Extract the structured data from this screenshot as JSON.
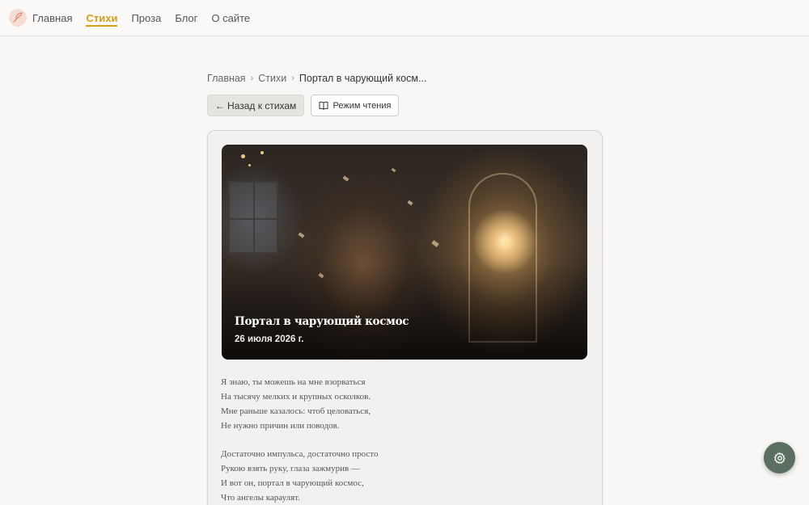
{
  "nav": {
    "items": [
      {
        "label": "Главная",
        "active": false
      },
      {
        "label": "Стихи",
        "active": true
      },
      {
        "label": "Проза",
        "active": false
      },
      {
        "label": "Блог",
        "active": false
      },
      {
        "label": "О сайте",
        "active": false
      }
    ],
    "accent_color": "#d4a017"
  },
  "breadcrumb": {
    "items": [
      "Главная",
      "Стихи"
    ],
    "current": "Портал в чарующий косм..."
  },
  "actions": {
    "back_label": "← Назад к стихам",
    "reading_mode_label": "Режим чтения"
  },
  "poem": {
    "title": "Портал в чарующий космос",
    "date": "26 июля 2026 г.",
    "stanzas": [
      [
        "Я знаю, ты можешь на мне взорваться",
        "На тысячу мелких и крупных осколков.",
        "Мне раньше казалось: чтоб целоваться,",
        "Не нужно причин или поводов."
      ],
      [
        "Достаточно импульса, достаточно просто",
        "Рукою взять руку, глаза зажмурив —",
        "И вот он, портал в чарующий космос,",
        "Что ангелы караулят."
      ]
    ]
  },
  "icons": {
    "logo": "feather-icon",
    "reading_mode": "book-open-icon",
    "settings": "gear-icon"
  },
  "colors": {
    "fab": "#5c6e5f",
    "logo_bg": "#f6ddd4"
  }
}
